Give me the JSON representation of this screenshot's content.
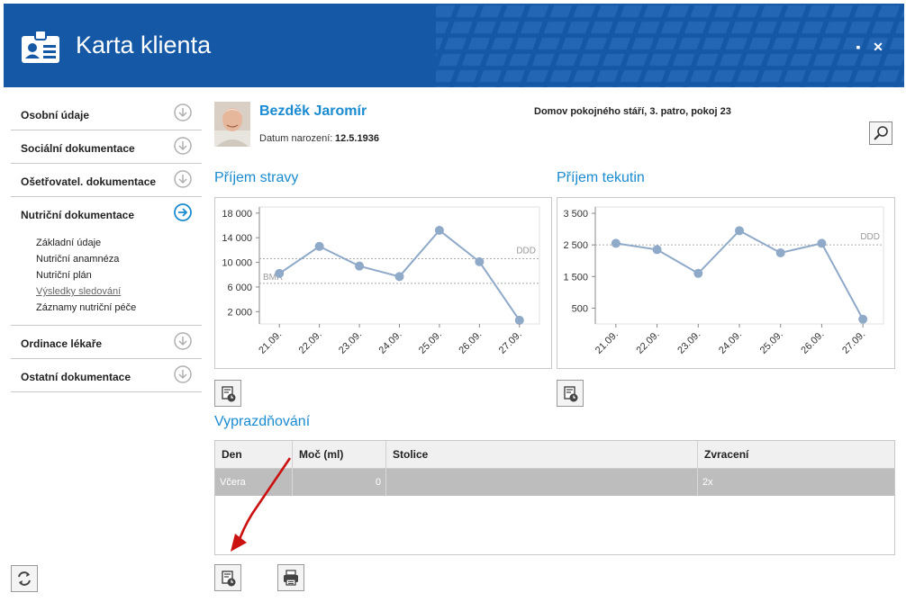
{
  "header": {
    "title": "Karta klienta",
    "maximize_symbol": "▪",
    "close_symbol": "✕",
    "icon": "id-card-icon"
  },
  "sidebar": {
    "items": [
      {
        "label": "Osobní údaje"
      },
      {
        "label": "Sociální dokumentace"
      },
      {
        "label": "Ošetřovatel. dokumentace"
      },
      {
        "label": "Nutriční dokumentace"
      },
      {
        "label": "Ordinace lékaře"
      },
      {
        "label": "Ostatní dokumentace"
      }
    ],
    "subitems": [
      "Základní údaje",
      "Nutriční anamnéza",
      "Nutriční plán",
      "Výsledky sledování",
      "Záznamy nutriční péče"
    ]
  },
  "client": {
    "name": "Bezděk Jaromír",
    "dob_label": "Datum narození:",
    "dob": "12.5.1936",
    "location": "Domov pokojného stáří, 3. patro, pokoj 23"
  },
  "sections": {
    "food": "Příjem stravy",
    "fluids": "Příjem tekutin",
    "elimination": "Vyprazdňování"
  },
  "chart_data": [
    {
      "type": "line",
      "title": "Příjem stravy",
      "x": [
        "21.09.",
        "22.09.",
        "23.09.",
        "24.09.",
        "25.09.",
        "26.09.",
        "27.09."
      ],
      "values": [
        8200,
        12600,
        9400,
        7700,
        15200,
        10100,
        600
      ],
      "yticks": [
        "18 000",
        "14 000",
        "10 000",
        "6 000",
        "2 000"
      ],
      "ytick_values": [
        18000,
        14000,
        10000,
        6000,
        2000
      ],
      "ylim": [
        0,
        19000
      ],
      "reference_lines": [
        {
          "label": "DDD",
          "value": 10600
        },
        {
          "label": "BMR",
          "value": 6600
        }
      ],
      "color": "#8fa9c9"
    },
    {
      "type": "line",
      "title": "Příjem tekutin",
      "x": [
        "21.09.",
        "22.09.",
        "23.09.",
        "24.09.",
        "25.09.",
        "26.09.",
        "27.09."
      ],
      "values": [
        2550,
        2350,
        1600,
        2950,
        2250,
        2550,
        150
      ],
      "yticks": [
        "3 500",
        "2 500",
        "1 500",
        "500"
      ],
      "ytick_values": [
        3500,
        2500,
        1500,
        500
      ],
      "ylim": [
        0,
        3700
      ],
      "reference_lines": [
        {
          "label": "DDD",
          "value": 2500
        }
      ],
      "color": "#8fa9c9"
    }
  ],
  "table": {
    "columns": [
      "Den",
      "Moč (ml)",
      "Stolice",
      "Zvracení"
    ],
    "rows": [
      {
        "den": "Včera",
        "moc": "0",
        "stolice": "",
        "zvraceni": "2x"
      }
    ]
  },
  "colors": {
    "header": "#1559a6",
    "accent": "#1a8bd1",
    "annotation": "#cc1111"
  }
}
